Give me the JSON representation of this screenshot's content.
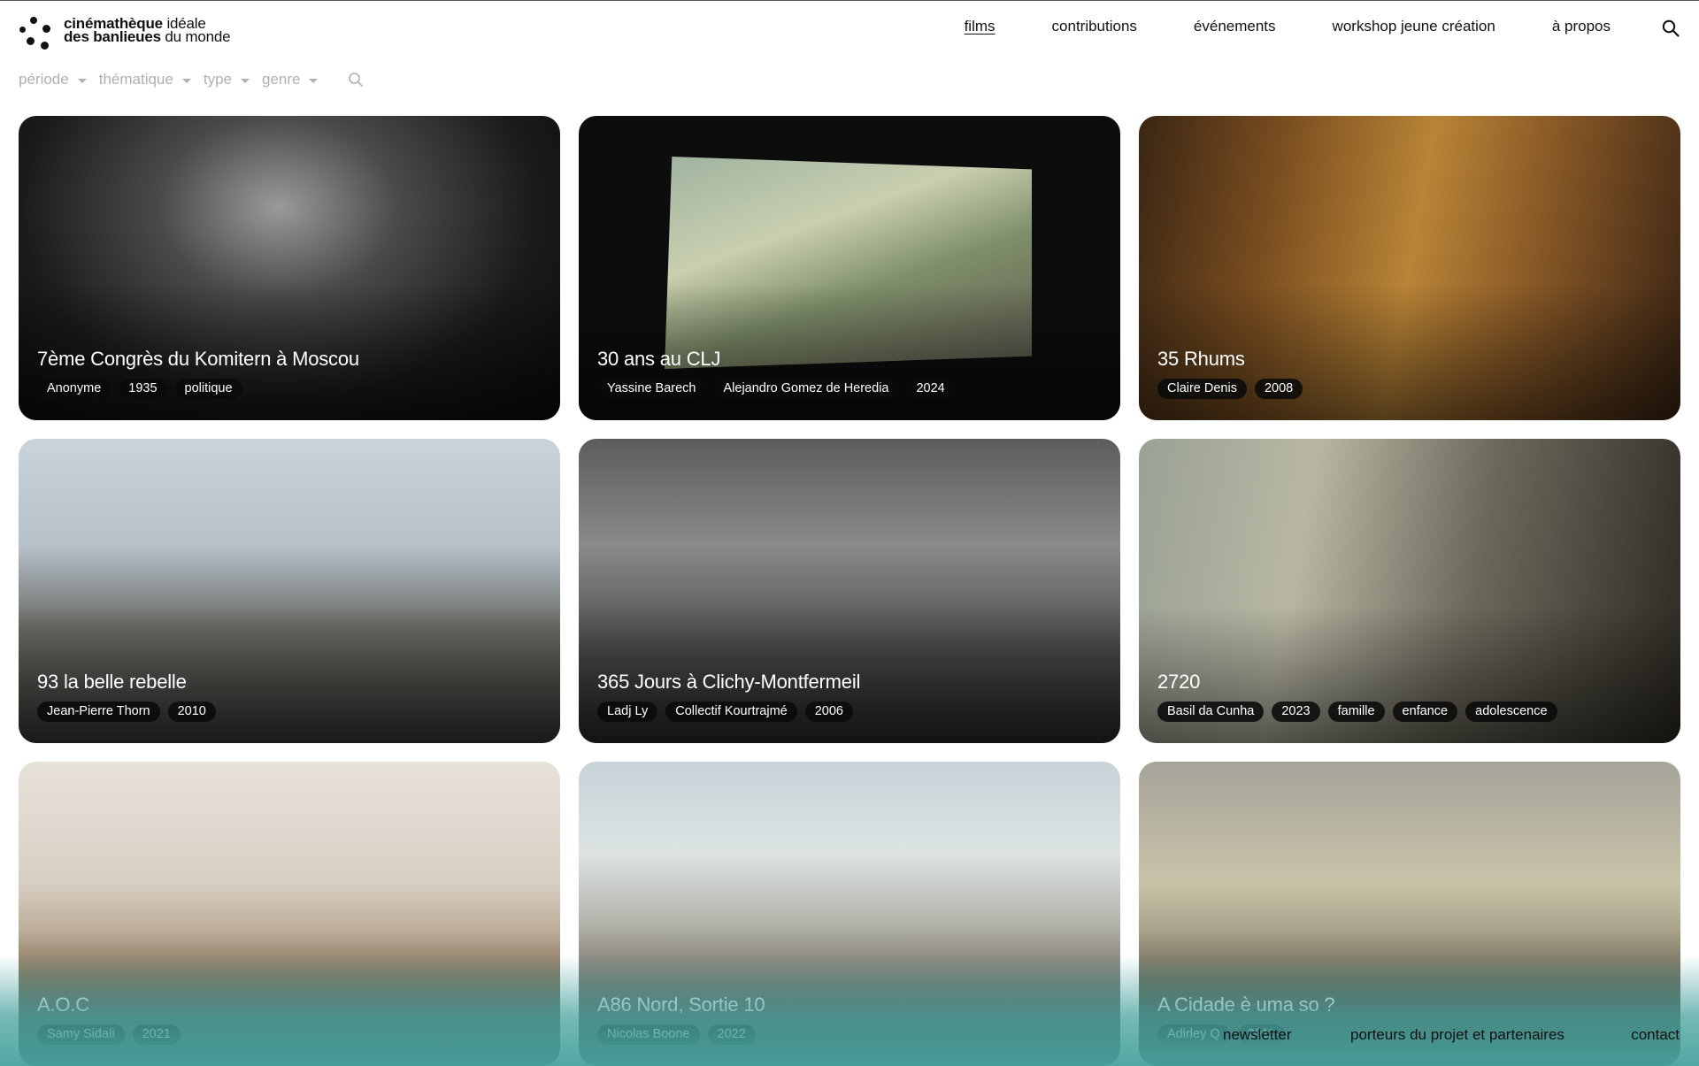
{
  "site": {
    "logo_line1_bold": "cinémathèque",
    "logo_line1_rest": " idéale",
    "logo_line2_bold": "des banlieues",
    "logo_line2_rest": " du monde"
  },
  "nav": {
    "items": [
      {
        "label": "films",
        "active": true
      },
      {
        "label": "contributions"
      },
      {
        "label": "événements"
      },
      {
        "label": "workshop jeune création"
      },
      {
        "label": "à propos"
      }
    ],
    "search_icon": "search-icon"
  },
  "filters": {
    "items": [
      {
        "label": "période"
      },
      {
        "label": "thématique"
      },
      {
        "label": "type"
      },
      {
        "label": "genre"
      }
    ],
    "search_icon": "search-icon"
  },
  "films": [
    {
      "title": "7ème Congrès du Komitern à Moscou",
      "tags": [
        "Anonyme",
        "1935",
        "politique"
      ]
    },
    {
      "title": "30 ans au CLJ",
      "tags": [
        "Yassine Barech",
        "Alejandro Gomez de Heredia",
        "2024"
      ]
    },
    {
      "title": "35 Rhums",
      "tags": [
        "Claire Denis",
        "2008"
      ]
    },
    {
      "title": "93 la belle rebelle",
      "tags": [
        "Jean-Pierre Thorn",
        "2010"
      ]
    },
    {
      "title": "365 Jours à Clichy-Montfermeil",
      "tags": [
        "Ladj Ly",
        "Collectif Kourtrajmé",
        "2006"
      ]
    },
    {
      "title": "2720",
      "tags": [
        "Basil da Cunha",
        "2023",
        "famille",
        "enfance",
        "adolescence"
      ]
    },
    {
      "title": "A.O.C",
      "tags": [
        "Samy Sidali",
        "2021"
      ]
    },
    {
      "title": "A86 Nord, Sortie 10",
      "tags": [
        "Nicolas Boone",
        "2022"
      ]
    },
    {
      "title": "A Cidade è uma so ?",
      "tags": [
        "Adirley Q",
        "2011"
      ]
    }
  ],
  "footer": {
    "newsletter": "newsletter",
    "partners": "porteurs du projet et partenaires",
    "contact": "contact"
  },
  "colors": {
    "footer_teal": "#48a29e",
    "tag_bg": "#0a0a0a",
    "filter_grey": "#b0b0b0"
  }
}
